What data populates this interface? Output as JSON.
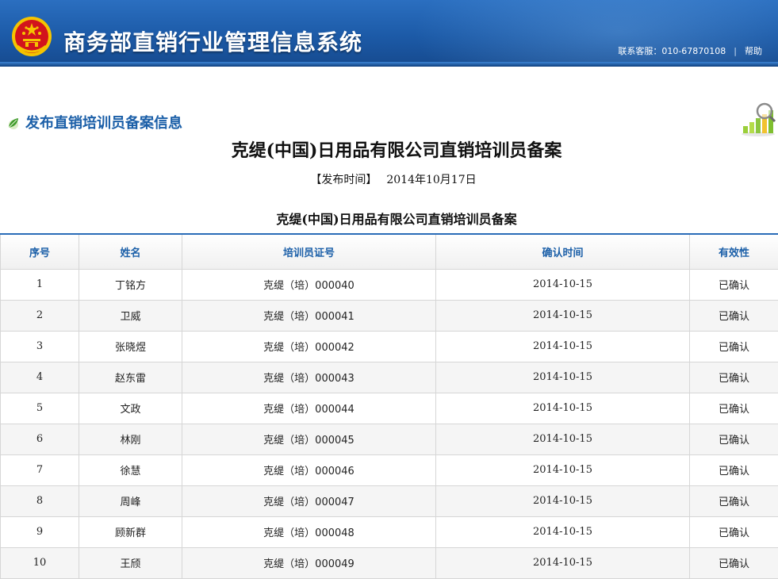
{
  "header": {
    "site_title": "商务部直销行业管理信息系统",
    "hotline": "联系客服：010-67870108",
    "separator": "|",
    "help_label": "帮助"
  },
  "section": {
    "title": "发布直销培训员备案信息",
    "icon": "leaf-icon",
    "side_icon": "chart-magnifier-icon"
  },
  "article": {
    "title": "克缇(中国)日用品有限公司直销培训员备案",
    "publish_label": "【发布时间】",
    "publish_date": "2014年10月17日",
    "table_caption": "克缇(中国)日用品有限公司直销培训员备案"
  },
  "table": {
    "headers": [
      "序号",
      "姓名",
      "培训员证号",
      "确认时间",
      "有效性"
    ],
    "rows": [
      [
        "1",
        "丁铭方",
        "克缇（培）000040",
        "2014-10-15",
        "已确认"
      ],
      [
        "2",
        "卫威",
        "克缇（培）000041",
        "2014-10-15",
        "已确认"
      ],
      [
        "3",
        "张晓煜",
        "克缇（培）000042",
        "2014-10-15",
        "已确认"
      ],
      [
        "4",
        "赵东雷",
        "克缇（培）000043",
        "2014-10-15",
        "已确认"
      ],
      [
        "5",
        "文政",
        "克缇（培）000044",
        "2014-10-15",
        "已确认"
      ],
      [
        "6",
        "林刚",
        "克缇（培）000045",
        "2014-10-15",
        "已确认"
      ],
      [
        "7",
        "徐慧",
        "克缇（培）000046",
        "2014-10-15",
        "已确认"
      ],
      [
        "8",
        "周峰",
        "克缇（培）000047",
        "2014-10-15",
        "已确认"
      ],
      [
        "9",
        "顾新群",
        "克缇（培）000048",
        "2014-10-15",
        "已确认"
      ],
      [
        "10",
        "王颀",
        "克缇（培）000049",
        "2014-10-15",
        "已确认"
      ]
    ]
  },
  "colors": {
    "header_blue": "#1c5aa7",
    "accent_blue": "#1b5fa8",
    "emblem_red": "#d2141c",
    "emblem_gold": "#f5c400"
  }
}
